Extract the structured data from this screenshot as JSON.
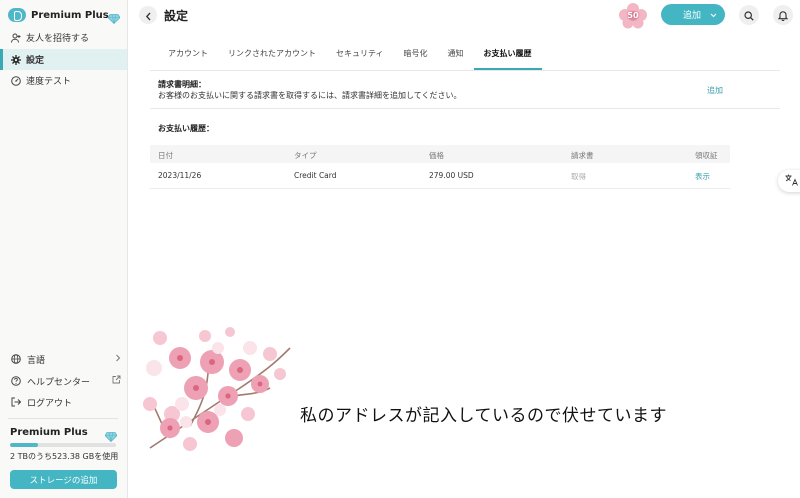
{
  "colors": {
    "accent": "#44b6c3",
    "link": "#3a9fb0",
    "blossom": "#f2a9bb"
  },
  "sidebar": {
    "brand": "Premium Plus",
    "items": [
      {
        "label": "友人を招待する",
        "icon": "add-person-icon"
      },
      {
        "label": "設定",
        "icon": "gear-icon",
        "active": true
      },
      {
        "label": "速度テスト",
        "icon": "speedometer-icon"
      }
    ],
    "bottom_items": [
      {
        "label": "言語",
        "icon": "globe-icon"
      },
      {
        "label": "ヘルプセンター",
        "icon": "help-circle-icon"
      },
      {
        "label": "ログアウト",
        "icon": "logout-icon"
      }
    ],
    "plan": {
      "title": "Premium Plus",
      "storage_text": "2 TBのうち523.38 GBを使用",
      "used_fraction": 0.26,
      "button": "ストレージの追加"
    }
  },
  "header": {
    "title": "設定",
    "promo_badge": "50",
    "add_button": "追加"
  },
  "tabs": [
    {
      "label": "アカウント"
    },
    {
      "label": "リンクされたアカウント"
    },
    {
      "label": "セキュリティ"
    },
    {
      "label": "暗号化"
    },
    {
      "label": "通知"
    },
    {
      "label": "お支払い履歴",
      "active": true
    }
  ],
  "invoice": {
    "title": "請求書明細：",
    "description": "お客様のお支払いに関する請求書を取得するには、請求書詳細を追加してください。",
    "add_link": "追加"
  },
  "payment_history": {
    "title": "お支払い履歴：",
    "columns": [
      "日付",
      "タイプ",
      "価格",
      "請求書",
      "領収証"
    ],
    "rows": [
      {
        "date": "2023/11/26",
        "type": "Credit Card",
        "price": "279.00 USD",
        "invoice": "取得",
        "receipt": "表示"
      }
    ]
  },
  "overlay": {
    "text": "私のアドレスが記入しているので伏せています"
  }
}
